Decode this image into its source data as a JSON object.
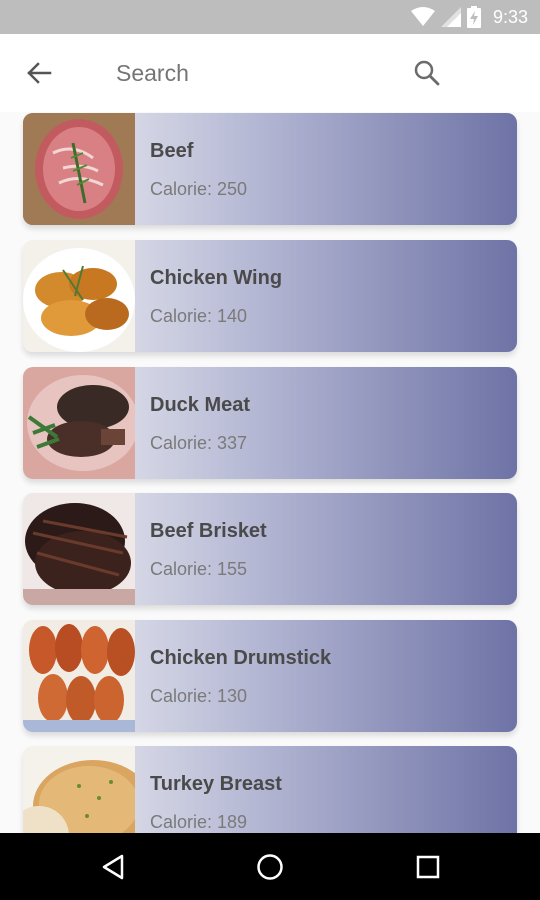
{
  "status_bar": {
    "time": "9:33",
    "icons": [
      "wifi-icon",
      "signal-icon",
      "battery-charging-icon"
    ]
  },
  "app_bar": {
    "back_icon": "arrow-left-icon",
    "search_placeholder": "Search",
    "search_icon": "search-icon"
  },
  "items": [
    {
      "name": "Beef",
      "calorie_label": "Calorie: 250",
      "thumb": "beef-steak-image"
    },
    {
      "name": "Chicken Wing",
      "calorie_label": "Calorie: 140",
      "thumb": "chicken-wings-image"
    },
    {
      "name": "Duck Meat",
      "calorie_label": "Calorie: 337",
      "thumb": "duck-meat-image"
    },
    {
      "name": "Beef Brisket",
      "calorie_label": "Calorie: 155",
      "thumb": "beef-brisket-image"
    },
    {
      "name": "Chicken Drumstick",
      "calorie_label": "Calorie: 130",
      "thumb": "chicken-drumstick-image"
    },
    {
      "name": "Turkey Breast",
      "calorie_label": "Calorie: 189",
      "thumb": "turkey-breast-image"
    }
  ],
  "nav_bar": {
    "buttons": [
      "back-triangle-icon",
      "home-circle-icon",
      "recents-square-icon"
    ]
  },
  "colors": {
    "card_gradient_start": "#f3f3f6",
    "card_gradient_end": "#6e73a6",
    "status_bar": "#bdbdbd",
    "nav_bar": "#000000"
  }
}
